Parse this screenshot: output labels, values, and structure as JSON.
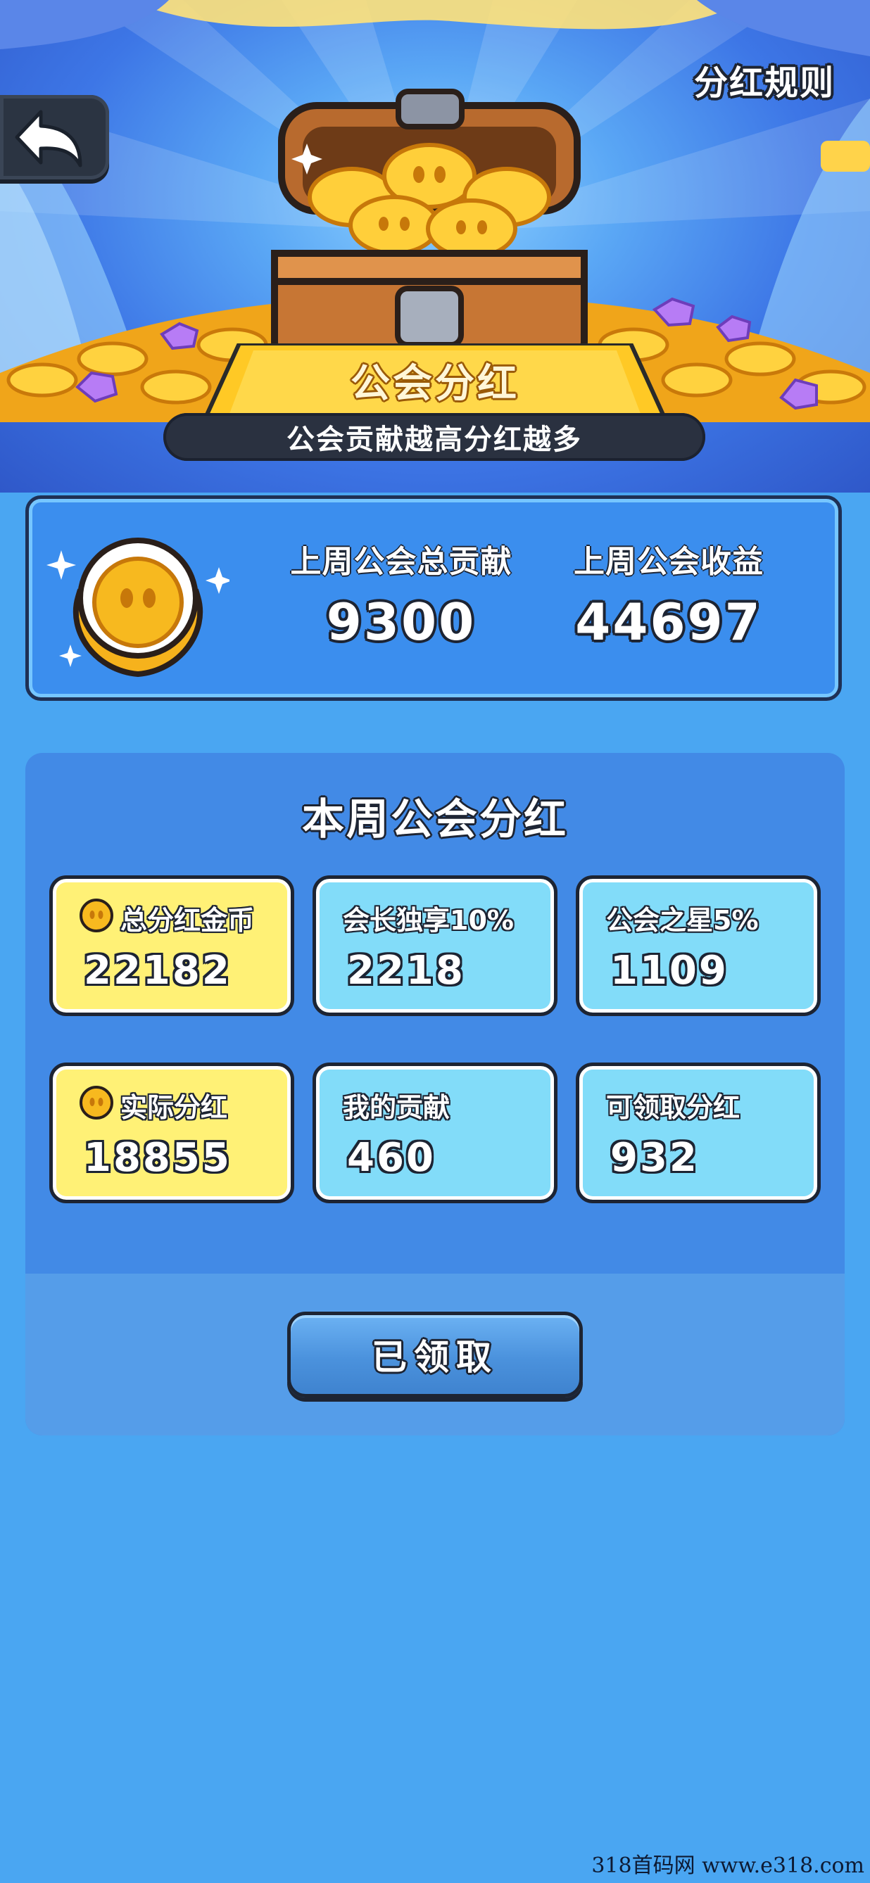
{
  "header": {
    "back_icon": "back-arrow-icon",
    "rules_label": "分红规则"
  },
  "banner": {
    "title": "公会分红",
    "subtitle": "公会贡献越高分红越多"
  },
  "last_week": {
    "contribution_label": "上周公会总贡献",
    "contribution_value": "9300",
    "income_label": "上周公会收益",
    "income_value": "44697"
  },
  "this_week": {
    "title": "本周公会分红",
    "tiles": [
      {
        "label": "总分红金币",
        "value": "22182",
        "icon": "coin-icon"
      },
      {
        "label": "会长独享10%",
        "value": "2218"
      },
      {
        "label": "公会之星5%",
        "value": "1109"
      },
      {
        "label": "实际分红",
        "value": "18855",
        "icon": "coin-icon"
      },
      {
        "label": "我的贡献",
        "value": "460"
      },
      {
        "label": "可领取分红",
        "value": "932"
      }
    ],
    "claim_button": "已领取"
  },
  "watermark": "318首码网 www.e318.com",
  "colors": {
    "background": "#4aa6f2",
    "panel": "#428ae6",
    "tile_yellow": "#fff176",
    "tile_cyan": "#82dcf9",
    "outline": "#1d2433",
    "gold": "#f7b91f"
  }
}
